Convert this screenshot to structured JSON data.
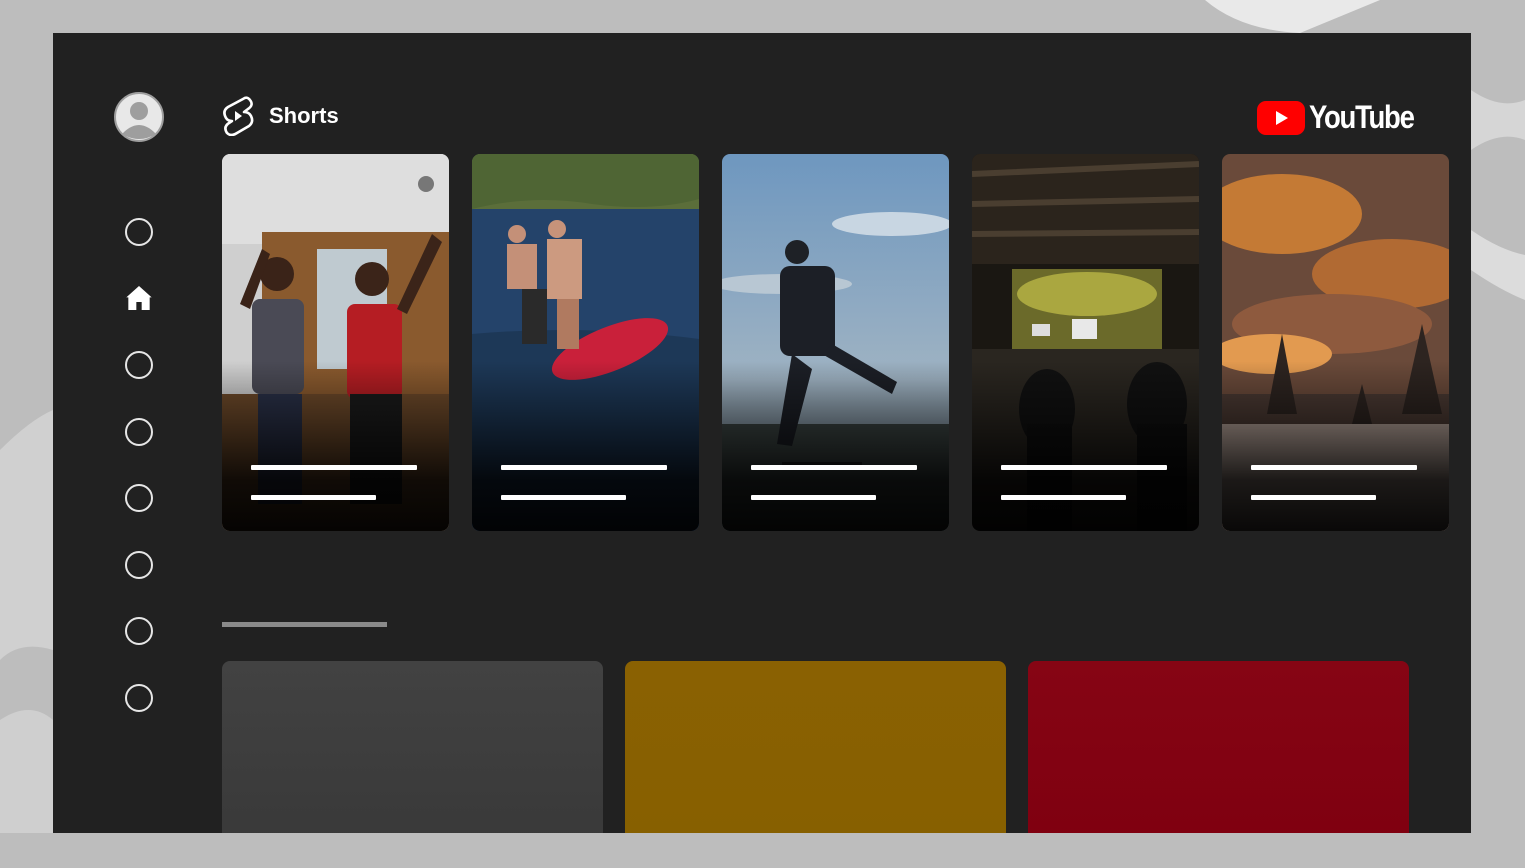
{
  "header": {
    "section_title": "Shorts",
    "brand_name": "YouTube",
    "brand_color": "#ff0000"
  },
  "sidebar": {
    "items": [
      {
        "icon": "circle-icon"
      },
      {
        "icon": "home-icon",
        "selected": true
      },
      {
        "icon": "circle-icon"
      },
      {
        "icon": "circle-icon"
      },
      {
        "icon": "circle-icon"
      },
      {
        "icon": "circle-icon"
      },
      {
        "icon": "circle-icon"
      },
      {
        "icon": "circle-icon"
      }
    ]
  },
  "shorts": [
    {
      "scene": "two-girls-dancing"
    },
    {
      "scene": "people-on-inflatable-tube"
    },
    {
      "scene": "man-skateboarding-at-dusk"
    },
    {
      "scene": "concert-hall-audience"
    },
    {
      "scene": "sunset-clouds-over-trees"
    }
  ],
  "tiles": [
    {
      "color": "#424242"
    },
    {
      "color": "#8a6102"
    },
    {
      "color": "#860514"
    }
  ]
}
